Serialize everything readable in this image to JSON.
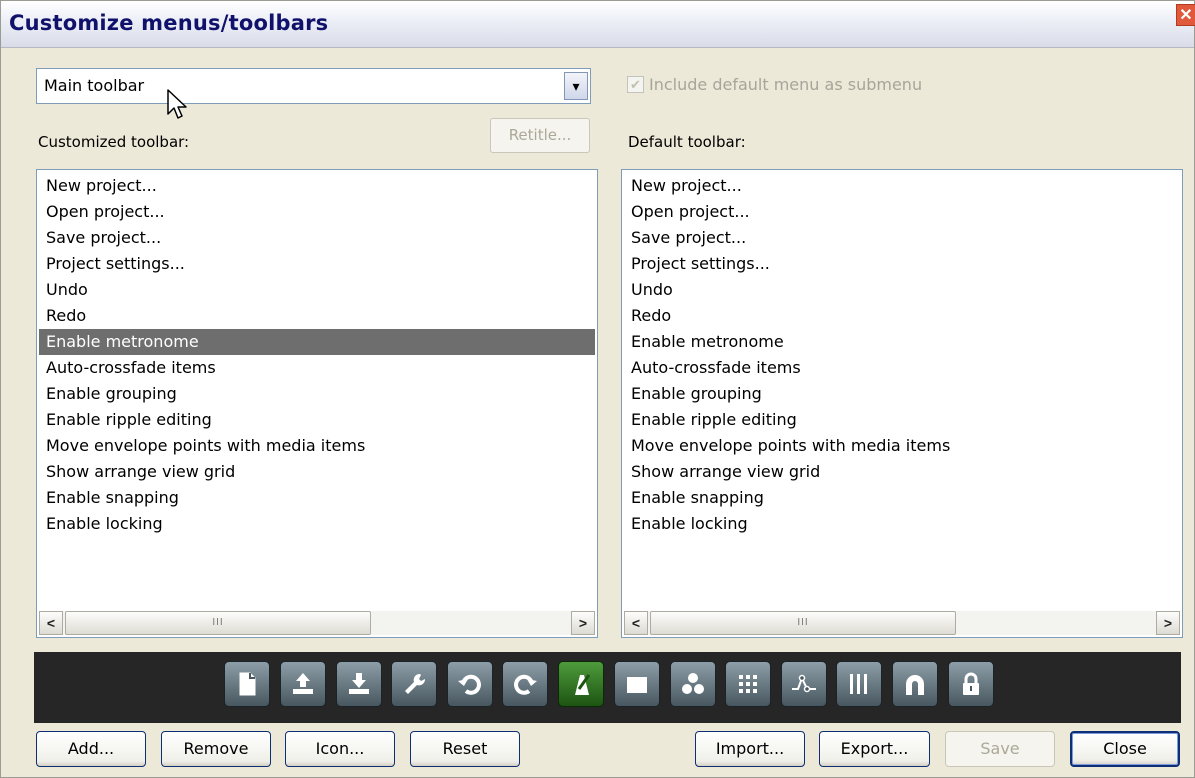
{
  "window": {
    "title": "Customize menus/toolbars"
  },
  "dropdown": {
    "value": "Main toolbar"
  },
  "include_default": {
    "label": "Include default menu as submenu",
    "checked": true
  },
  "customized": {
    "label": "Customized toolbar:",
    "retitle_label": "Retitle..."
  },
  "default_tb": {
    "label": "Default toolbar:"
  },
  "customized_items": [
    "New project...",
    "Open project...",
    "Save project...",
    "Project settings...",
    "Undo",
    "Redo",
    "Enable metronome",
    "Auto-crossfade items",
    "Enable grouping",
    "Enable ripple editing",
    "Move envelope points with media items",
    "Show arrange view grid",
    "Enable snapping",
    "Enable locking"
  ],
  "selected_item": "Enable metronome",
  "default_items": [
    "New project...",
    "Open project...",
    "Save project...",
    "Project settings...",
    "Undo",
    "Redo",
    "Enable metronome",
    "Auto-crossfade items",
    "Enable grouping",
    "Enable ripple editing",
    "Move envelope points with media items",
    "Show arrange view grid",
    "Enable snapping",
    "Enable locking"
  ],
  "scrollbar_thumb_text": "III",
  "toolbar_icons": [
    "new-project-icon",
    "open-project-icon",
    "save-project-icon",
    "project-settings-icon",
    "undo-icon",
    "redo-icon",
    "metronome-icon",
    "crossfade-icon",
    "grouping-icon",
    "grid-icon",
    "envelope-icon",
    "ripple-icon",
    "snapping-icon",
    "locking-icon"
  ],
  "toolbar_active_icon": "metronome-icon",
  "buttons": {
    "add": "Add...",
    "remove": "Remove",
    "icon": "Icon...",
    "reset": "Reset",
    "import": "Import...",
    "export": "Export...",
    "save": "Save",
    "close": "Close"
  },
  "colors": {
    "selection": "#6e6e6e",
    "toolbar_bg": "#262626",
    "active_icon": "#3f8a2f"
  }
}
